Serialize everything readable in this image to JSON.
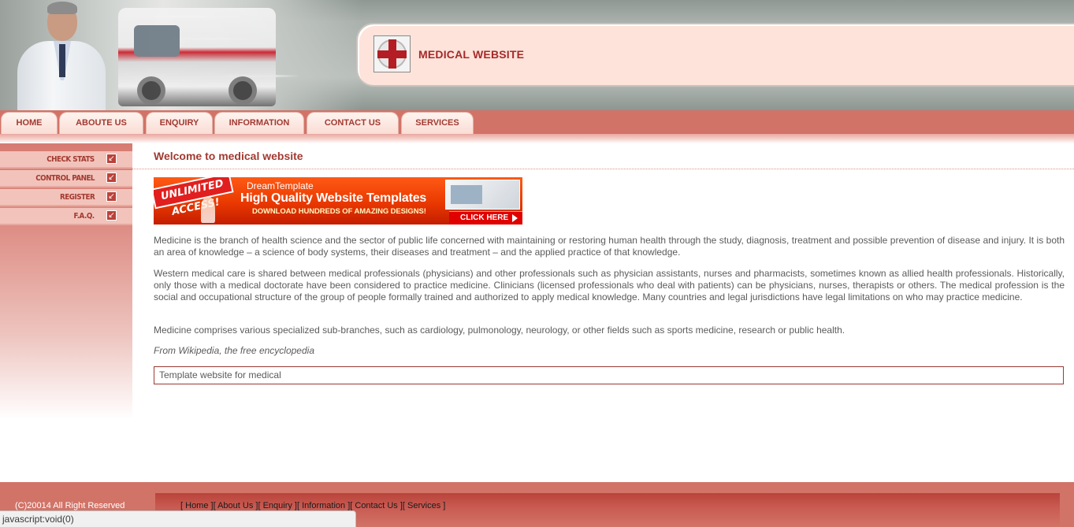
{
  "header": {
    "site_title": "MEDICAL WEBSITE",
    "logo_icon": "red-cross-icon"
  },
  "nav": {
    "tabs": [
      "HOME",
      "ABOUTE US",
      "ENQUIRY",
      "INFORMATION",
      "CONTACT US",
      "SERVICES"
    ]
  },
  "sidebar": {
    "items": [
      {
        "label": "CHECK STATS",
        "icon": "arrow-icon"
      },
      {
        "label": "CONTROL PANEL",
        "icon": "arrow-icon"
      },
      {
        "label": "REGISTER",
        "icon": "arrow-icon"
      },
      {
        "label": "F.A.Q.",
        "icon": "arrow-icon"
      }
    ]
  },
  "content": {
    "heading": "Welcome to medical website",
    "banner": {
      "badge": "UNLIMITED ACCESS!",
      "brand": "DreamTemplate",
      "headline": "High Quality Website Templates",
      "sub": "DOWNLOAD HUNDREDS OF AMAZING DESIGNS!",
      "cta": "CLICK HERE"
    },
    "paragraphs": [
      "Medicine is the branch of health science and the sector of public life concerned with maintaining or restoring human health through the study, diagnosis, treatment and possible prevention of disease and injury. It is both an area of knowledge – a science of body systems, their diseases and treatment – and the applied practice of that knowledge.",
      "Western medical care is shared between medical professionals (physicians) and other professionals such as physician assistants, nurses and pharmacists, sometimes known as allied health professionals. Historically, only those with a medical doctorate have been considered to practice medicine. Clinicians (licensed professionals who deal with patients) can be physicians, nurses, therapists or others. The medical profession is the social and occupational structure of the group of people formally trained and authorized to apply medical knowledge. Many countries and legal jurisdictions have legal limitations on who may practice medicine.",
      "Medicine comprises various specialized sub-branches, such as cardiology, pulmonology, neurology, or other fields such as sports medicine, research or public health."
    ],
    "source": "From Wikipedia, the free encyclopedia",
    "template_note": "Template website for medical"
  },
  "footer": {
    "copyright": "(C)20014 All Right Reserved",
    "links": [
      "Home",
      "About Us",
      "Enquiry",
      "Information",
      "Contact Us",
      "Services"
    ]
  },
  "statusbar": {
    "text": "javascript:void(0)"
  },
  "colors": {
    "accent": "#d27367",
    "title": "#a42a2a",
    "text": "#5b5b5b"
  }
}
